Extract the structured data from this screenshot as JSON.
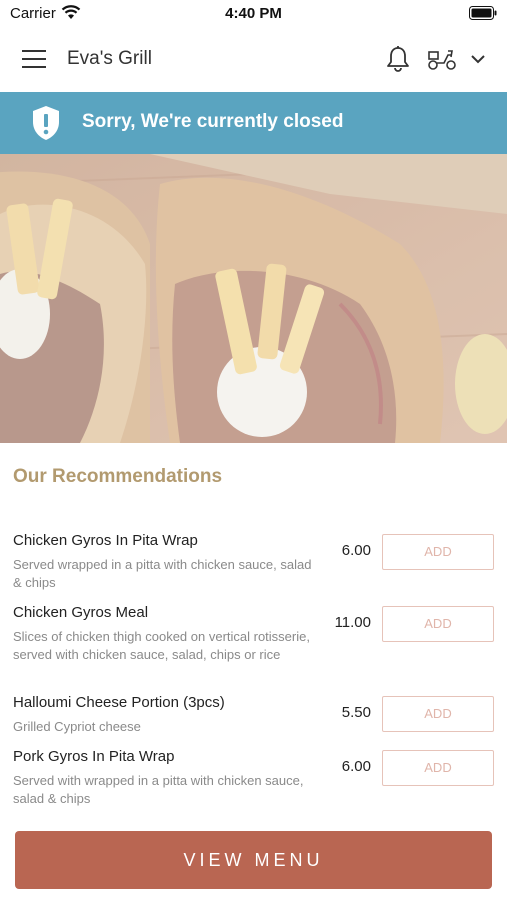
{
  "status_bar": {
    "carrier": "Carrier",
    "time": "4:40 PM"
  },
  "header": {
    "title": "Eva's Grill",
    "icons": [
      "menu-icon",
      "bell-icon",
      "delivery-scooter-icon",
      "chevron-down-icon"
    ]
  },
  "banner": {
    "text": "Sorry, We're currently closed",
    "icon": "shield-icon",
    "color": "#5aa4c0"
  },
  "hero": {
    "image": "gyros-wraps-photo"
  },
  "recommendations": {
    "title": "Our Recommendations",
    "items": [
      {
        "name": "Chicken Gyros In Pita Wrap",
        "description": "Served wrapped in a pitta with chicken sauce, salad & chips",
        "price": "6.00",
        "add_label": "ADD"
      },
      {
        "name": "Chicken Gyros Meal",
        "description": "Slices of chicken thigh cooked on vertical rotisserie, served with chicken sauce, salad, chips or rice",
        "price": "11.00",
        "add_label": "ADD"
      },
      {
        "name": "Halloumi Cheese Portion (3pcs)",
        "description": "Grilled Cypriot cheese",
        "price": "5.50",
        "add_label": "ADD"
      },
      {
        "name": "Pork Gyros In Pita Wrap",
        "description": "Served with wrapped in a pitta with chicken sauce, salad & chips",
        "price": "6.00",
        "add_label": "ADD"
      }
    ]
  },
  "footer": {
    "view_menu_label": "VIEW MENU",
    "button_color": "#b96652"
  },
  "colors": {
    "accent": "#b29a6f",
    "add_border": "#e6c3b9"
  }
}
